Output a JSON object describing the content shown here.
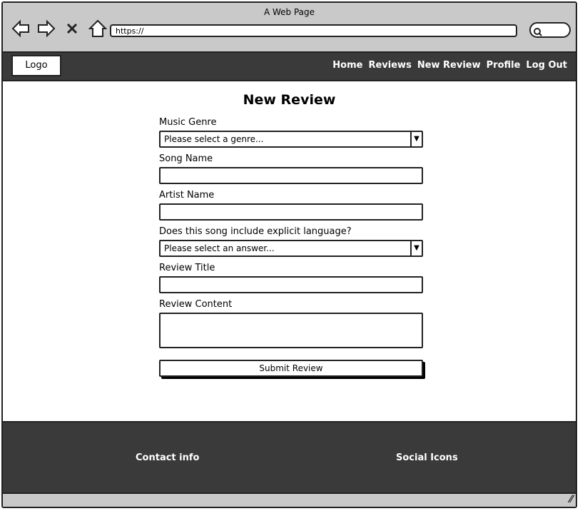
{
  "window": {
    "title": "A Web Page"
  },
  "browser": {
    "url": "https://"
  },
  "header": {
    "logo": "Logo",
    "nav": [
      "Home",
      "Reviews",
      "New Review",
      "Profile",
      "Log Out"
    ]
  },
  "page": {
    "title": "New Review"
  },
  "form": {
    "genre": {
      "label": "Music Genre",
      "value": "Please select a genre..."
    },
    "song": {
      "label": "Song Name",
      "value": ""
    },
    "artist": {
      "label": "Artist Name",
      "value": ""
    },
    "explicit": {
      "label": "Does this song include explicit language?",
      "value": "Please select an answer..."
    },
    "review_title": {
      "label": "Review Title",
      "value": ""
    },
    "review_content": {
      "label": "Review Content",
      "value": ""
    },
    "submit": "Submit Review"
  },
  "footer": {
    "contact": "Contact info",
    "social": "Social Icons"
  }
}
